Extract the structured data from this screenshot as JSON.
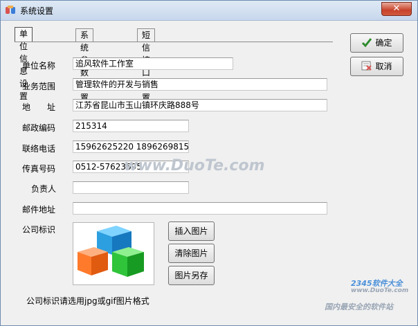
{
  "window": {
    "title": "系统设置",
    "close_label": "✕"
  },
  "tabs": [
    {
      "label": "单位信息设置",
      "active": true
    },
    {
      "label": "系统参数设置",
      "active": false
    },
    {
      "label": "短信接口设置",
      "active": false
    }
  ],
  "form": {
    "company_name": {
      "label": "单位名称",
      "value": "追风软件工作室"
    },
    "business_scope": {
      "label": "业务范围",
      "value": "管理软件的开发与销售"
    },
    "address": {
      "label": "地　　址",
      "value": "江苏省昆山市玉山镇环庆路888号"
    },
    "postal_code": {
      "label": "邮政编码",
      "value": "215314"
    },
    "phone": {
      "label": "联络电话",
      "value": "15962625220 18962698151"
    },
    "fax": {
      "label": "传真号码",
      "value": "0512-57623695"
    },
    "manager": {
      "label": "负责人",
      "value": ""
    },
    "email": {
      "label": "邮件地址",
      "value": ""
    },
    "logo": {
      "label": "公司标识"
    }
  },
  "buttons": {
    "ok": "确定",
    "cancel": "取消",
    "insert_image": "插入图片",
    "clear_image": "清除图片",
    "save_image_as": "图片另存"
  },
  "hint": "公司标识请选用jpg或gif图片格式",
  "watermarks": {
    "center": "www.DuoTe.com",
    "corner_brand": "2345软件大全",
    "corner_url": "www.DuoTe.com",
    "corner_slogan": "国内最安全的软件站"
  },
  "colors": {
    "close_button": "#c7432b",
    "ok_check": "#2e8b2e"
  },
  "icons": {
    "app": "app-icon",
    "ok": "checkmark-icon",
    "cancel": "cancel-icon"
  }
}
